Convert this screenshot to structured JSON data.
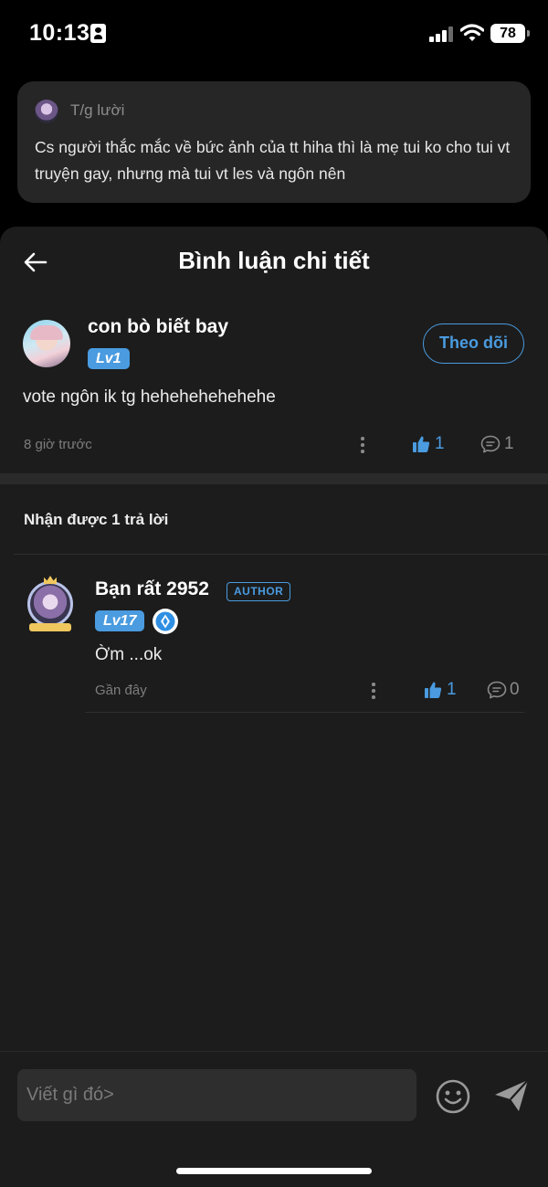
{
  "status_bar": {
    "time": "10:13",
    "battery": "78"
  },
  "preview": {
    "author": "T/g lười",
    "text": "Cs người thắc mắc về bức ảnh của tt hiha thì là mẹ tui ko cho tui vt truyện gay, nhưng mà tui vt les và ngôn nên"
  },
  "header": {
    "title": "Bình luận chi tiết"
  },
  "main_comment": {
    "username": "con bò biết bay",
    "level": "Lv1",
    "follow_label": "Theo dõi",
    "text": "vote ngôn ik tg hehehehehehehe",
    "time": "8 giờ trước",
    "likes": "1",
    "replies": "1"
  },
  "replies_heading": "Nhận được 1 trả lời",
  "reply": {
    "username": "Bạn rất 2952",
    "author_tag": "AUTHOR",
    "level": "Lv17",
    "text": "Ờm ...ok",
    "time": "Gần đây",
    "likes": "1",
    "replies": "0"
  },
  "composer": {
    "placeholder": "Viết gì đó>"
  },
  "colors": {
    "accent": "#4a9be0",
    "sheet_bg": "#1c1c1c",
    "card_bg": "#262626"
  }
}
